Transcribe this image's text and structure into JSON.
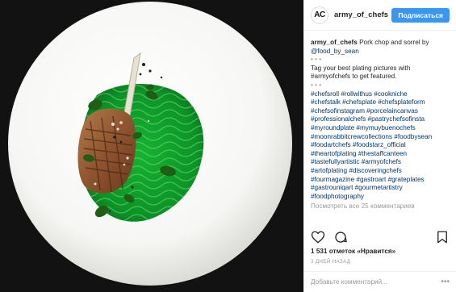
{
  "header": {
    "avatar_text": "AC",
    "username": "army_of_chefs",
    "follow_label": "Подписаться"
  },
  "caption": {
    "username": "army_of_chefs",
    "text": "Pork chop and sorrel by",
    "mention": "@food_by_sean",
    "dots1": "• • •",
    "tag_line_1": "Tag your best plating pictures with",
    "tag_line_2": "#armyofchefs to get featured.",
    "dots2": "• • •"
  },
  "hashtags": [
    "#chefsroll #rollwithus #cookniche",
    "#chefstalk #chefsplate #chefsplateform",
    "#chefsofinstagram #porcelaincanvas",
    "#professionalchefs #pastrychefsofinsta",
    "#myroundplate #mymuybuenochefs",
    "#moonrabbitcrewcollections #foodbysean",
    "#foodartchefs #foodstarz_official",
    "#theartofplating #thestaffcanteen",
    "#tastefullyartistic #armyofchefs",
    "#artofplating #discoveringchefs",
    "#fourmagazine #gastroart #grateplates",
    "#gastrouniqart #gourmetartistry",
    "#foodphotography"
  ],
  "view_all_comments": "Посмотреть все 25 комментариев",
  "likes": "1 531 отметок «Нравится»",
  "time_ago": "3 ДНЕЙ НАЗАД",
  "comment_placeholder": "Добавьте комментарий...",
  "more_options": "•••",
  "icons": {
    "like": "heart-icon",
    "comment": "comment-icon",
    "save": "bookmark-icon"
  },
  "colors": {
    "follow_button": "#3897f0",
    "link": "#003569",
    "muted": "#999999",
    "sauce_green": "#0fa02a"
  }
}
